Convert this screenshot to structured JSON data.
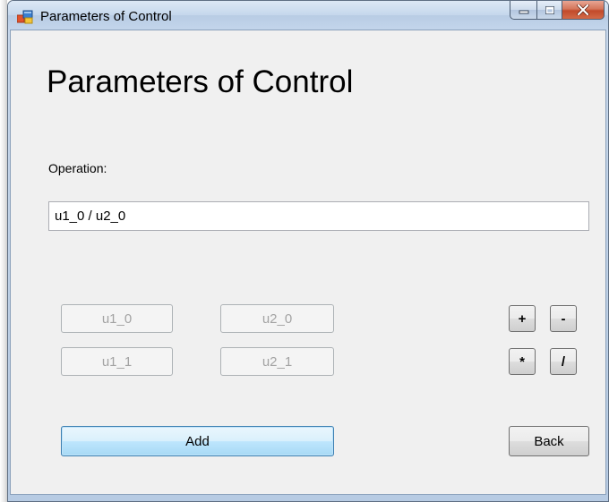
{
  "window": {
    "title": "Parameters of Control"
  },
  "caption": {
    "minimize_icon": "minimize-icon",
    "maximize_icon": "maximize-icon",
    "close_icon": "close-icon"
  },
  "form": {
    "heading": "Parameters of Control",
    "operation_label": "Operation:",
    "operation_value": "u1_0 / u2_0"
  },
  "variables": [
    {
      "label": "u1_0",
      "enabled": false
    },
    {
      "label": "u2_0",
      "enabled": false
    },
    {
      "label": "u1_1",
      "enabled": false
    },
    {
      "label": "u2_1",
      "enabled": false
    }
  ],
  "operators": [
    {
      "label": "+"
    },
    {
      "label": "-"
    },
    {
      "label": "*"
    },
    {
      "label": "/"
    }
  ],
  "actions": {
    "add_label": "Add",
    "back_label": "Back"
  },
  "colors": {
    "titlebar": "#c5d7ec",
    "close_button": "#c24a2b",
    "add_button": "#bee6fd",
    "client_background": "#f0f0f0"
  }
}
